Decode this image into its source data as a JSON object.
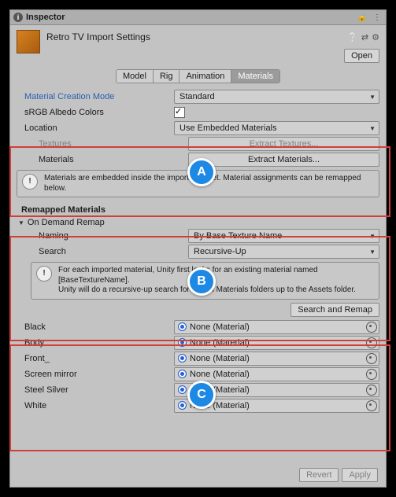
{
  "header": {
    "title": "Inspector",
    "subtitle": "Retro TV Import Settings",
    "open_btn": "Open"
  },
  "tabs": {
    "model": "Model",
    "rig": "Rig",
    "animation": "Animation",
    "materials": "Materials"
  },
  "fields": {
    "creation_mode_label": "Material Creation Mode",
    "creation_mode_value": "Standard",
    "srgb_label": "sRGB Albedo Colors",
    "location_label": "Location",
    "location_value": "Use Embedded Materials",
    "textures_label": "Textures",
    "extract_textures_btn": "Extract Textures...",
    "materials_label": "Materials",
    "extract_materials_btn": "Extract Materials..."
  },
  "msg_embedded": "Materials are embedded inside the imported asset. Material assignments can be remapped below.",
  "remapped_header": "Remapped Materials",
  "remap": {
    "fold_label": "On Demand Remap",
    "naming_label": "Naming",
    "naming_value": "By Base Texture Name",
    "search_label": "Search",
    "search_value": "Recursive-Up",
    "msg": "For each imported material, Unity first looks for an existing material named [BaseTextureName].\nUnity will do a recursive-up search for it in all Materials folders up to the Assets folder.",
    "search_btn": "Search and Remap"
  },
  "mat_none": "None (Material)",
  "materials": {
    "m0": "Black",
    "m1": "Body",
    "m2": "Front_",
    "m3": "Screen mirror",
    "m4": "Steel Silver",
    "m5": "White"
  },
  "footer": {
    "revert": "Revert",
    "apply": "Apply"
  },
  "badges": {
    "a": "A",
    "b": "B",
    "c": "C"
  }
}
